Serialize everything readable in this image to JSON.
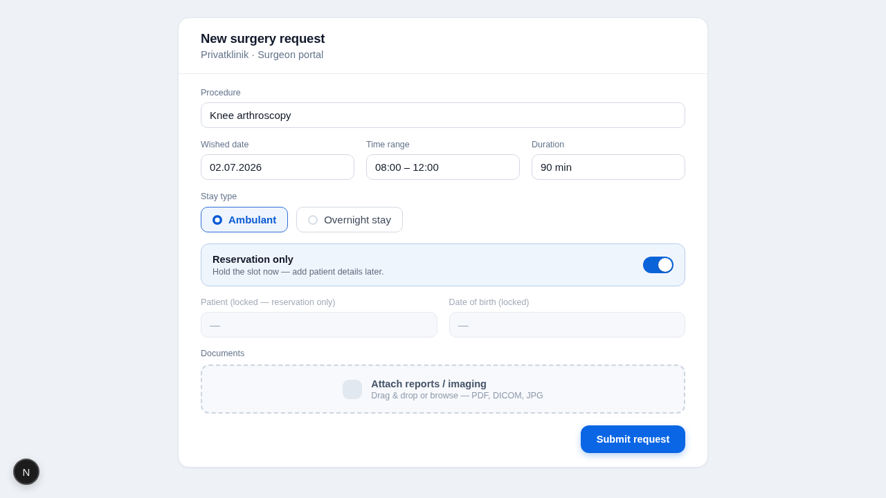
{
  "header": {
    "title": "New surgery request",
    "subtitle": "Privatklinik · Surgeon portal"
  },
  "procedure": {
    "label": "Procedure",
    "value": "Knee arthroscopy"
  },
  "schedule": [
    {
      "label": "Wished date",
      "value": "02.07.2026"
    },
    {
      "label": "Time range",
      "value": "08:00 – 12:00"
    },
    {
      "label": "Duration",
      "value": "90 min"
    }
  ],
  "stay_type": {
    "label": "Stay type",
    "options": [
      {
        "label": "Ambulant",
        "selected": true
      },
      {
        "label": "Overnight stay",
        "selected": false
      }
    ]
  },
  "reservation": {
    "title": "Reservation only",
    "description": "Hold the slot now — add patient details later.",
    "on": true
  },
  "patient_fields": [
    {
      "label": "Patient (locked — reservation only)",
      "placeholder": "—",
      "disabled": true
    },
    {
      "label": "Date of birth (locked)",
      "placeholder": "—",
      "disabled": true
    }
  ],
  "documents": {
    "label": "Documents",
    "title": "Attach reports / imaging",
    "hint": "Drag & drop or browse — PDF, DICOM, JPG"
  },
  "submit_button": "Submit request",
  "dev_indicator": {
    "label": "N"
  }
}
